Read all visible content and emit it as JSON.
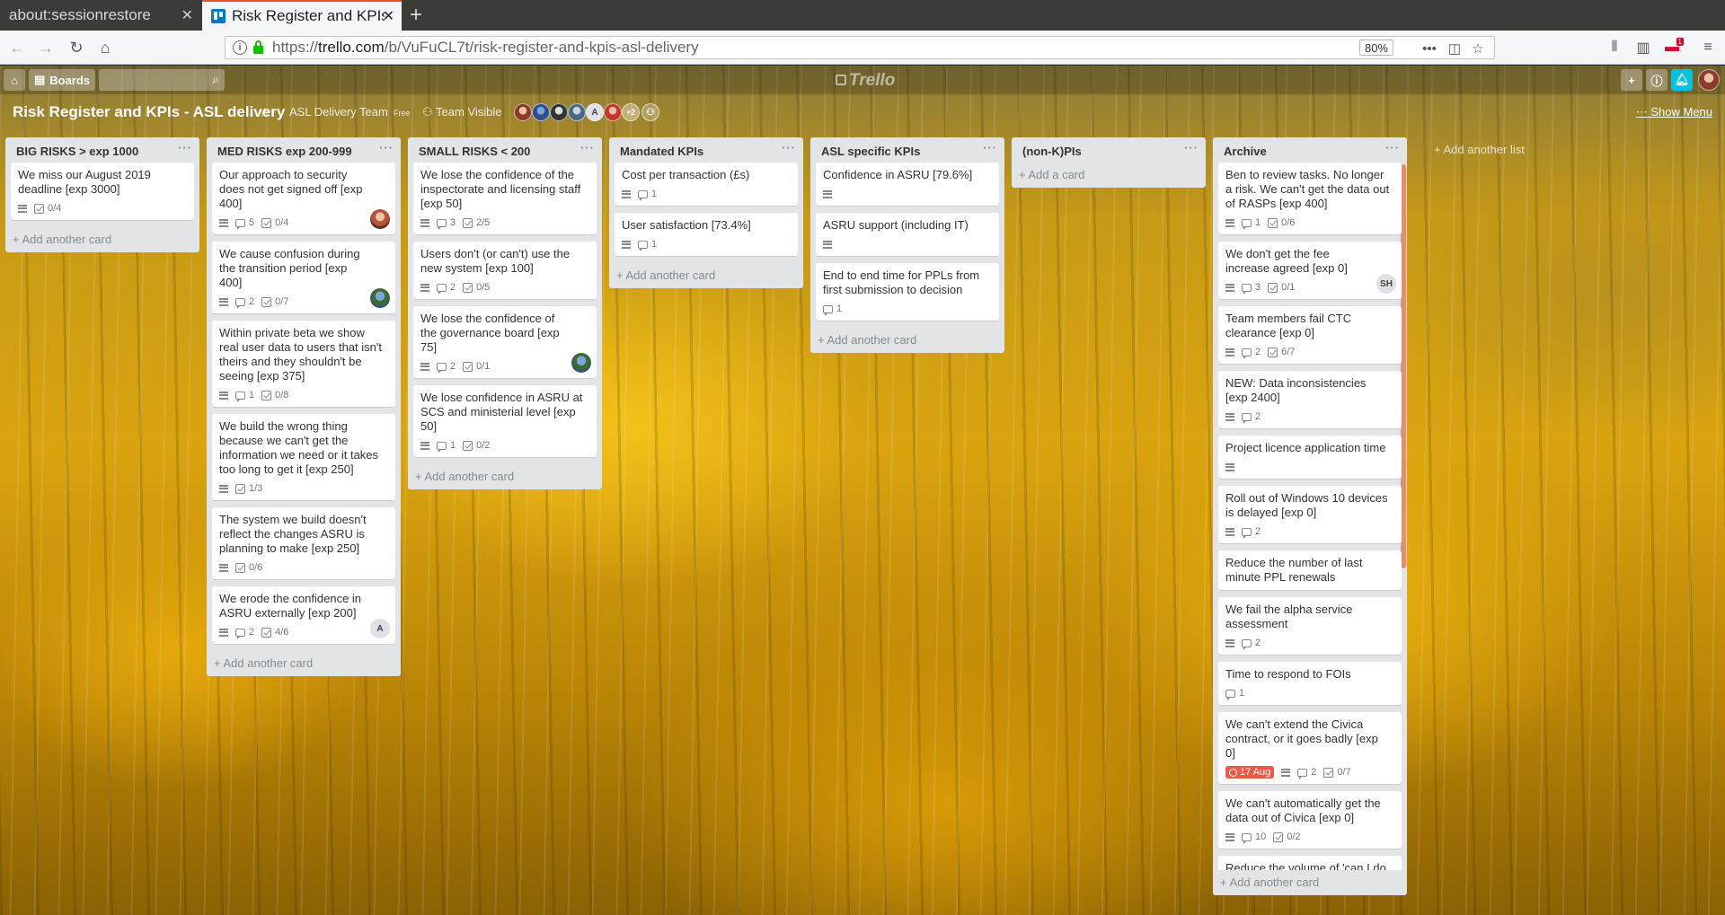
{
  "browser": {
    "tabs": [
      {
        "title": "about:sessionrestore",
        "close": "✕"
      },
      {
        "title": "Risk Register and KPIs - ASL delivery",
        "close": "✕"
      }
    ],
    "new_tab": "+",
    "url_prefix": "https://",
    "url_host": "trello.com",
    "url_path": "/b/VuFuCL7t/risk-register-and-kpis-asl-delivery",
    "zoom": "80%",
    "ext_badge": "1"
  },
  "trello": {
    "boards_label": "Boards",
    "logo_text": "Trello",
    "board_title": "Risk Register and KPIs - ASL delivery",
    "team": "ASL Delivery Team",
    "team_badge": "Free",
    "visibility": "Team Visible",
    "member_count": "+2",
    "member_initial": "A",
    "show_menu": "Show Menu",
    "add_list": "+ Add another list"
  },
  "lists": [
    {
      "title": "BIG RISKS > exp 1000",
      "add": "+ Add another card",
      "cards": [
        {
          "title": "We miss our August 2019 deadline [exp 3000]",
          "desc": true,
          "check": "0/4"
        }
      ]
    },
    {
      "title": "MED RISKS exp 200-999",
      "add": "+ Add another card",
      "cards": [
        {
          "title": "Our approach to security does not get signed off [exp 400]",
          "desc": true,
          "comments": "5",
          "check": "0/4",
          "avatar": "photo-a"
        },
        {
          "title": "We cause confusion during the transition period [exp 400]",
          "desc": true,
          "comments": "2",
          "check": "0/7",
          "avatar": "photo-b"
        },
        {
          "title": "Within private beta we show real user data to users that isn't theirs and they shouldn't be seeing [exp 375]",
          "desc": true,
          "comments": "1",
          "check": "0/8"
        },
        {
          "title": "We build the wrong thing because we can't get the information we need or it takes too long to get it [exp 250]",
          "desc": true,
          "check": "1/3"
        },
        {
          "title": "The system we build doesn't reflect the changes ASRU is planning to make [exp 250]",
          "desc": true,
          "check": "0/6"
        },
        {
          "title": "We erode the confidence in ASRU externally [exp 200]",
          "desc": true,
          "comments": "2",
          "check": "4/6",
          "avatar": "A"
        }
      ]
    },
    {
      "title": "SMALL RISKS < 200",
      "add": "+ Add another card",
      "cards": [
        {
          "title": "We lose the confidence of the inspectorate and licensing staff [exp 50]",
          "desc": true,
          "comments": "3",
          "check": "2/5"
        },
        {
          "title": "Users don't (or can't) use the new system [exp 100]",
          "desc": true,
          "comments": "2",
          "check": "0/5"
        },
        {
          "title": "We lose the confidence of the governance board [exp 75]",
          "desc": true,
          "comments": "2",
          "check": "0/1",
          "avatar": "photo-b"
        },
        {
          "title": "We lose confidence in ASRU at SCS and ministerial level [exp 50]",
          "desc": true,
          "comments": "1",
          "check": "0/2"
        }
      ]
    },
    {
      "title": "Mandated KPIs",
      "add": "+ Add another card",
      "cards": [
        {
          "title": "Cost per transaction (£s)",
          "desc": true,
          "comments": "1"
        },
        {
          "title": "User satisfaction [73.4%]",
          "desc": true,
          "comments": "1"
        }
      ]
    },
    {
      "title": "ASL specific KPIs",
      "add": "+ Add another card",
      "cards": [
        {
          "title": "Confidence in ASRU [79.6%]",
          "desc": true
        },
        {
          "title": "ASRU support (including IT)",
          "desc": true
        },
        {
          "title": "End to end time for PPLs from first submission to decision",
          "comments": "1"
        }
      ]
    },
    {
      "title": "(non-K)PIs",
      "add": "+ Add a card",
      "cards": []
    },
    {
      "title": "Archive",
      "add": "+ Add another card",
      "cards": [
        {
          "title": "Ben to review tasks. No longer a risk. We can't get the data out of RASPs [exp 400]",
          "desc": true,
          "comments": "1",
          "check": "0/6"
        },
        {
          "title": "We don't get the fee increase agreed [exp 0]",
          "desc": true,
          "comments": "3",
          "check": "0/1",
          "avatar": "SH"
        },
        {
          "title": "Team members fail CTC clearance [exp 0]",
          "desc": true,
          "comments": "2",
          "check": "6/7"
        },
        {
          "title": "NEW: Data inconsistencies [exp 2400]",
          "desc": true,
          "comments": "2"
        },
        {
          "title": "Project licence application time",
          "desc": true
        },
        {
          "title": "Roll out of Windows 10 devices is delayed [exp 0]",
          "desc": true,
          "comments": "2"
        },
        {
          "title": "Reduce the number of last minute PPL renewals"
        },
        {
          "title": "We fail the alpha service assessment",
          "desc": true,
          "comments": "2"
        },
        {
          "title": "Time to respond to FOIs",
          "comments": "1"
        },
        {
          "title": "We can't extend the Civica contract, or it goes badly [exp 0]",
          "due": "17 Aug",
          "desc": true,
          "comments": "2",
          "check": "0/7"
        },
        {
          "title": "We can't automatically get the data out of Civica [exp 0]",
          "desc": true,
          "comments": "10",
          "check": "0/2"
        },
        {
          "title": "Reduce the volume of 'can I do this?' queries"
        }
      ]
    }
  ]
}
